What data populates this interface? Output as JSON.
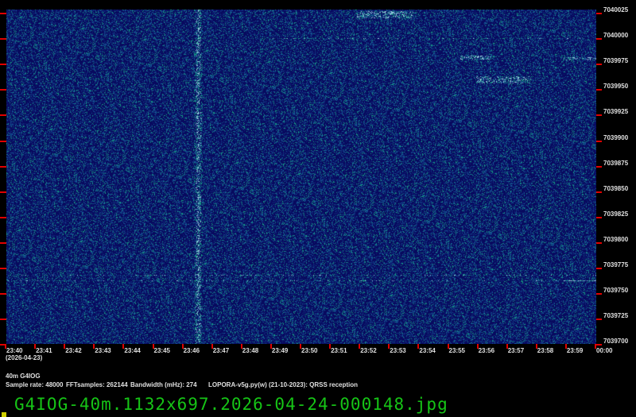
{
  "y_axis_labels": [
    "7040025",
    "7040000",
    "7039975",
    "7039950",
    "7039925",
    "7039900",
    "7039875",
    "7039850",
    "7039825",
    "7039800",
    "7039775",
    "7039750",
    "7039725",
    "7039700"
  ],
  "x_axis_labels": [
    "23:40",
    "23:41",
    "23:42",
    "23:43",
    "23:44",
    "23:45",
    "23:46",
    "23:47",
    "23:48",
    "23:49",
    "23:50",
    "23:51",
    "23:52",
    "23:53",
    "23:54",
    "23:55",
    "23:56",
    "23:57",
    "23:58",
    "23:59",
    "00:00"
  ],
  "date": "(2026-04-23)",
  "station": "40m G4IOG",
  "sample_rate": "Sample rate: 48000",
  "fft_samples": "FFTsamples: 262144",
  "bandwidth": "Bandwidth (mHz): 274",
  "software": "LOPORA-v5g.py(w) (21-10-2023): QRSS reception",
  "filename": "G4IOG-40m.1132x697.2026-04-24-000148.jpg",
  "colors": {
    "background": "#0a0a5a",
    "tick": "#e00000",
    "filename": "#16c416"
  }
}
